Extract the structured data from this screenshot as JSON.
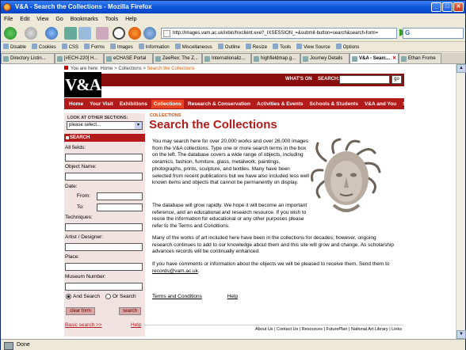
{
  "window": {
    "title": "V&A - Search the Collections - Mozilla Firefox"
  },
  "menu": [
    "File",
    "Edit",
    "View",
    "Go",
    "Bookmarks",
    "Tools",
    "Help"
  ],
  "url": "http://images.vam.ac.uk/ixbin/hixclient.exe?_IXSESSION_=&submit-button=search&search-form=",
  "devtoolbar": [
    "Disable",
    "Cookies",
    "CSS",
    "Forms",
    "Images",
    "Information",
    "Miscellaneous",
    "Outline",
    "Resize",
    "Tools",
    "View Source",
    "Options"
  ],
  "tabs": [
    "Directory Listin...",
    "[#ECH-220] H...",
    "eCHASE Portal",
    "ZeeRex: The Z...",
    "Internationaliz...",
    "highfieldmap.g...",
    "Journey Details",
    "V&A - Searc...",
    "Ethan Frome"
  ],
  "page": {
    "breadcrumb_prefix": "You are here: Home > Collections >",
    "breadcrumb_current": "Search the Collections",
    "logo": "V&A",
    "whats_on": "WHAT'S ON",
    "search_label": "SEARCH:",
    "go": "go",
    "nav": [
      "Home",
      "Your Visit",
      "Exhibitions",
      "Collections",
      "Research & Conservation",
      "Activities & Events",
      "Schools & Students",
      "V&A and You",
      "Shop Online"
    ],
    "sidebar": {
      "look_at": "LOOK AT OTHER SECTIONS:",
      "select_value": "please select...",
      "search_header": "SEARCH",
      "all_fields": "All fields:",
      "object_name": "Object Name:",
      "date": "Date:",
      "from": "From:",
      "to": "To:",
      "techniques": "Techniques:",
      "artist": "Artist / Designer:",
      "place": "Place:",
      "museum_number": "Museum Number:",
      "and_search": "And Search",
      "or_search": "Or Search",
      "clear_form": "clear form",
      "search_btn": "search",
      "basic_search": "Basic search >>",
      "help": "Help"
    },
    "section_label": "COLLECTIONS",
    "heading": "Search the Collections",
    "para1": "You may search here for over 20,000 works and over 26,000 images from the V&A collections. Type one or more search terms in the box on the left. The database covers a wide range of objects, including ceramics, fashion, furniture, glass, metalwork, paintings, photographs, prints, sculpture, and textiles. Many have been selected from recent publications but we have also included less well known items and objects that cannot be permanently on display.",
    "para2": "The database will grow rapidly. We hope it will become an important reference, and an educational and research resource. If you wish to reuse the information for educational or any other purposes please refer to the Terms and Conditions.",
    "para3": "Many of the works of art included here have been in the collections for decades; however, ongoing research continues to add to our knowledge about them and this site will grow and change. As scholarship advances records will be continually enhanced.",
    "para4_pre": "If you have comments or information about the objects we will be pleased to receive them. Send them to",
    "email": "records@vam.ac.uk",
    "terms": "Terms and Conditions",
    "help": "Help",
    "footer": "About Us  |  Contact Us  |  Resources  |  FuturePlan  |  National Art Library  |  Links"
  },
  "status": "Done"
}
